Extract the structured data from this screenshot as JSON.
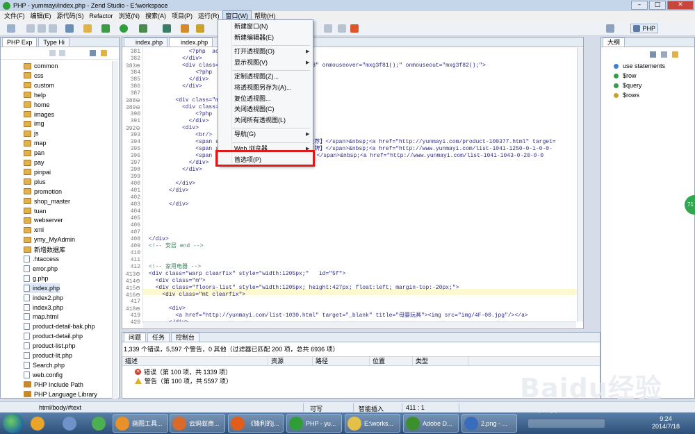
{
  "titlebar": {
    "title": "PHP - yummayi/index.php - Zend Studio - E:\\workspace"
  },
  "menubar": [
    "文件(F)",
    "编辑(E)",
    "源代码(S)",
    "Refactor",
    "浏览(N)",
    "搜索(A)",
    "项目(P)",
    "运行(R)",
    "窗口(W)",
    "帮助(H)"
  ],
  "toolbar": {
    "perspective_label": "PHP"
  },
  "left_pane": {
    "tabs": [
      "PHP Exp",
      "Type Hi"
    ],
    "items": [
      {
        "label": "common",
        "type": "folder"
      },
      {
        "label": "css",
        "type": "folder"
      },
      {
        "label": "custom",
        "type": "folder"
      },
      {
        "label": "help",
        "type": "folder"
      },
      {
        "label": "home",
        "type": "folder"
      },
      {
        "label": "images",
        "type": "folder"
      },
      {
        "label": "img",
        "type": "folder"
      },
      {
        "label": "js",
        "type": "folder"
      },
      {
        "label": "map",
        "type": "folder"
      },
      {
        "label": "pan",
        "type": "folder"
      },
      {
        "label": "pay",
        "type": "folder"
      },
      {
        "label": "pinpai",
        "type": "folder"
      },
      {
        "label": "plus",
        "type": "folder"
      },
      {
        "label": "promotion",
        "type": "folder"
      },
      {
        "label": "shop_master",
        "type": "folder"
      },
      {
        "label": "tuan",
        "type": "folder"
      },
      {
        "label": "webserver",
        "type": "folder"
      },
      {
        "label": "xml",
        "type": "folder"
      },
      {
        "label": "ymy_MyAdmin",
        "type": "folder"
      },
      {
        "label": "新增数据库",
        "type": "folder"
      },
      {
        "label": ".htaccess",
        "type": "file"
      },
      {
        "label": "error.php",
        "type": "file"
      },
      {
        "label": "g.php",
        "type": "file"
      },
      {
        "label": "index.php",
        "type": "file",
        "selected": true
      },
      {
        "label": "index2.php",
        "type": "file"
      },
      {
        "label": "index3.php",
        "type": "file"
      },
      {
        "label": "map.html",
        "type": "file"
      },
      {
        "label": "product-detail-bak.php",
        "type": "file"
      },
      {
        "label": "product-detail.php",
        "type": "file"
      },
      {
        "label": "product-list.php",
        "type": "file"
      },
      {
        "label": "product-lit.php",
        "type": "file"
      },
      {
        "label": "Search.php",
        "type": "file"
      },
      {
        "label": "web.config",
        "type": "file"
      },
      {
        "label": "PHP Include Path",
        "type": "lib"
      },
      {
        "label": "PHP Language Library",
        "type": "lib"
      }
    ]
  },
  "editor": {
    "tabs": [
      "index.php",
      "index.php"
    ],
    "lines": [
      {
        "n": "381",
        "code": "            <?php  ac"
      },
      {
        "n": "382",
        "code": "          </div>"
      },
      {
        "n": "383⊖",
        "code": "          <div class=\"m                        3f8\" onmouseover=\"mxg3f81();\" onmouseout=\"mxg3f82();\">"
      },
      {
        "n": "384",
        "code": "              <?php  ac"
      },
      {
        "n": "385",
        "code": "            </div>"
      },
      {
        "n": "386",
        "code": "          </div>"
      },
      {
        "n": "387",
        "code": ""
      },
      {
        "n": "388⊖",
        "code": "        <div class=\"mer"
      },
      {
        "n": "389⊖",
        "code": "          <div class=\"m"
      },
      {
        "n": "390",
        "code": "              <?php  ac"
      },
      {
        "n": "391",
        "code": "            </div>"
      },
      {
        "n": "392⊖",
        "code": "          <div>"
      },
      {
        "n": "393",
        "code": "              <br/>"
      },
      {
        "n": "394",
        "code": "              <span sty                   ;【热门推荐】</span>&nbsp;<a href=\"http://yunmayi.com/product-100377.html\" target="
      },
      {
        "n": "395",
        "code": "              <span sty                   ;【电器大牌】</span>&nbsp;<a href=\"http://www.yunmayi.com/list-1041-1250-0-1-0-0-"
      },
      {
        "n": "396",
        "code": "              <span st                    家电当红】</span>&nbsp;<a href=\"http://www.yunmayi.com/list-1041-1043-0-20-0-0"
      },
      {
        "n": "397",
        "code": "            </div>"
      },
      {
        "n": "398",
        "code": "          </div>"
      },
      {
        "n": "399",
        "code": ""
      },
      {
        "n": "400",
        "code": "        </div>"
      },
      {
        "n": "401",
        "code": "      </div>"
      },
      {
        "n": "402",
        "code": ""
      },
      {
        "n": "403",
        "code": "      </div>"
      },
      {
        "n": "404",
        "code": ""
      },
      {
        "n": "405",
        "code": ""
      },
      {
        "n": "406",
        "code": ""
      },
      {
        "n": "407",
        "code": ""
      },
      {
        "n": "408",
        "code": "</div>"
      },
      {
        "n": "409",
        "code": "<!-- 安居 end -->"
      },
      {
        "n": "410",
        "code": ""
      },
      {
        "n": "411",
        "code": ""
      },
      {
        "n": "412",
        "code": "<!-- 家用电器 -->"
      },
      {
        "n": "413⊖",
        "code": "<div class=\"warp clearfix\" style=\"width:1205px;\"   id=\"5f\">"
      },
      {
        "n": "414⊖",
        "code": "  <div class=\"m\">"
      },
      {
        "n": "415⊖",
        "code": "  <div class=\"floors-list\" style=\"width:1205px; height:427px; float:left; margin-top:-20px;\">"
      },
      {
        "n": "416⊖",
        "code": "    <div class=\"mt clearfix\">"
      },
      {
        "n": "417",
        "code": ""
      },
      {
        "n": "418⊖",
        "code": "      <div>"
      },
      {
        "n": "419",
        "code": "        <a href=\"http://yunmayi.com/list-1030.html\" target=\"_blank\" title=\"母婴玩具\"><img src=\"img/4F-00.jpg\"/></a>"
      },
      {
        "n": "420",
        "code": "      </div>"
      }
    ]
  },
  "context_menu": {
    "items": [
      {
        "label": "新建窗口(N)",
        "submenu": false,
        "sep_before": false
      },
      {
        "label": "新建编辑器(E)",
        "submenu": false,
        "sep_before": false
      },
      {
        "label": "打开透视图(O)",
        "submenu": true,
        "sep_before": true
      },
      {
        "label": "显示视图(V)",
        "submenu": true,
        "sep_before": false
      },
      {
        "label": "定制透视图(Z)...",
        "submenu": false,
        "sep_before": true
      },
      {
        "label": "将透视图另存为(A)...",
        "submenu": false,
        "sep_before": false
      },
      {
        "label": "复位透视图...",
        "submenu": false,
        "sep_before": false
      },
      {
        "label": "关闭透视图(C)",
        "submenu": false,
        "sep_before": false
      },
      {
        "label": "关闭所有透视图(L)",
        "submenu": false,
        "sep_before": false
      },
      {
        "label": "导航(G)",
        "submenu": true,
        "sep_before": true
      },
      {
        "label": "Web 浏览器",
        "submenu": true,
        "sep_before": true
      },
      {
        "label": "首选项(P)",
        "submenu": false,
        "sep_before": false,
        "highlighted": true
      }
    ]
  },
  "outline": {
    "tab": "大纲",
    "items": [
      {
        "label": "use statements",
        "color": "#3b7fd6"
      },
      {
        "label": "$row",
        "color": "#2f9e44"
      },
      {
        "label": "$query",
        "color": "#2f9e44"
      },
      {
        "label": "$rows",
        "color": "#c9a227"
      }
    ]
  },
  "problems": {
    "tabs": [
      "问题",
      "任务",
      "控制台"
    ],
    "summary": "1,339 个错误，5,597 个警告，0 其他（过滤器已匹配 200 项，总共 6936 项）",
    "columns": [
      "描述",
      "资源",
      "路径",
      "位置",
      "类型"
    ],
    "rows": [
      {
        "label": "错误（第 100 项，共 1339 项）",
        "kind": "error"
      },
      {
        "label": "警告（第 100 项，共 5597 项）",
        "kind": "warning"
      }
    ]
  },
  "statusbar": {
    "path": "html/body/#text",
    "writable": "可写",
    "insert": "智能插入",
    "position": "411 : 1"
  },
  "taskbar": {
    "tasks": [
      {
        "label": "画图工具...",
        "color": "#e8912a"
      },
      {
        "label": "云蚂蚁商...",
        "color": "#d86a2a"
      },
      {
        "label": "《锋利的j...",
        "color": "#e25c1a"
      },
      {
        "label": "PHP - yu...",
        "color": "#2f9e3a"
      },
      {
        "label": "E:\\works...",
        "color": "#e2c04a"
      },
      {
        "label": "Adobe D...",
        "color": "#3b8f2d"
      },
      {
        "label": "2.png - ...",
        "color": "#3a6cbd"
      }
    ],
    "time": "9:24",
    "date": "2014/7/18"
  },
  "badge": {
    "text": "71"
  },
  "watermark": {
    "brand": "Baidu经验",
    "site": "jingyan.baidu.com"
  }
}
